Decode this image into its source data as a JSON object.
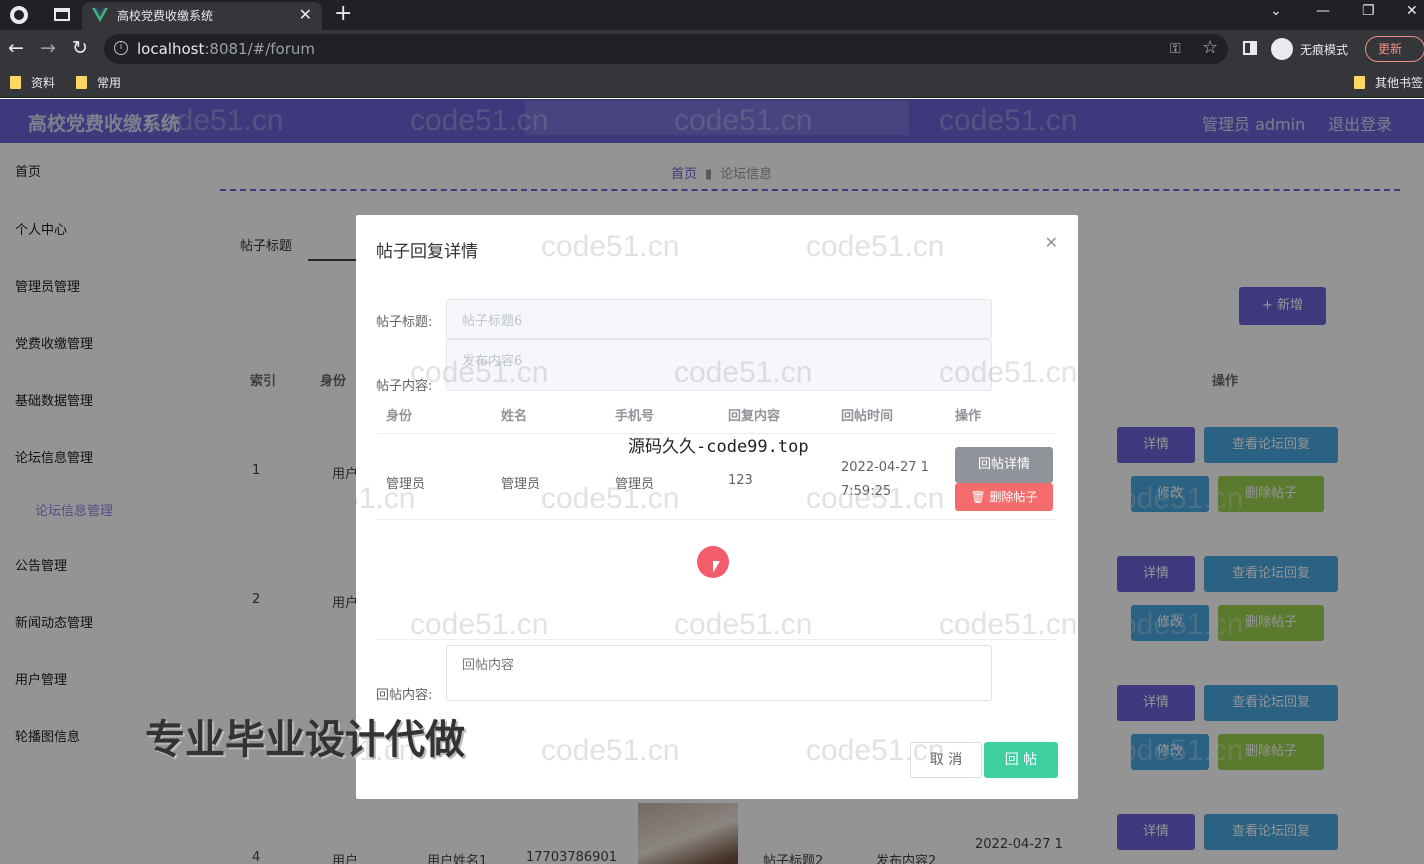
{
  "browser": {
    "tab_title": "高校党费收缴系统",
    "tab_close": "✕",
    "new_tab": "+",
    "url_host": "localhost",
    "url_rest": ":8081/#/forum",
    "incognito_label": "无痕模式",
    "update_label": "更新",
    "bookmarks": [
      "资料",
      "常用"
    ],
    "other_bookmarks": "其他书签",
    "win_min": "—",
    "win_max": "❐",
    "win_close": "✕",
    "tab_search": "⌄"
  },
  "header": {
    "title": "高校党费收缴系统",
    "user": "管理员 admin",
    "logout": "退出登录",
    "accent": "#6a63d6"
  },
  "sidebar": {
    "items": [
      "首页",
      "个人中心",
      "管理员管理",
      "党费收缴管理",
      "基础数据管理",
      "论坛信息管理",
      "公告管理",
      "新闻动态管理",
      "用户管理",
      "轮播图信息"
    ],
    "sub_item": "论坛信息管理"
  },
  "page": {
    "breadcrumb_home": "首页",
    "breadcrumb_current": "论坛信息",
    "search_label": "帖子标题",
    "add_button": "+ 新增",
    "columns": [
      "索引",
      "身份",
      "操作"
    ],
    "rows": [
      {
        "index": "1",
        "role": "用户"
      },
      {
        "index": "2",
        "role": "用户"
      },
      {
        "index": "4",
        "role": "用户",
        "name": "用户姓名1",
        "phone": "17703786901",
        "title": "帖子标题2",
        "content": "发布内容2",
        "time": "2022-04-27 1"
      }
    ],
    "op_detail": "详情",
    "op_replies": "查看论坛回复",
    "op_edit": "修改",
    "op_delete": "删除帖子"
  },
  "modal": {
    "title": "帖子回复详情",
    "title_label": "帖子标题:",
    "title_value": "帖子标题6",
    "content_label": "帖子内容:",
    "content_value": "发布内容6",
    "table_headers": [
      "身份",
      "姓名",
      "手机号",
      "回复内容",
      "回帖时间",
      "操作"
    ],
    "row": {
      "role": "管理员",
      "name": "管理员",
      "phone": "管理员",
      "reply": "123",
      "time_line1": "2022-04-27 1",
      "time_line2": "7:59:25"
    },
    "reply_detail_button": "回帖详情",
    "delete_button": "删除帖子",
    "reply_label": "回帖内容:",
    "reply_placeholder": "回帖内容",
    "cancel_button": "取 消",
    "submit_button": "回 帖"
  },
  "watermarks": {
    "site": "code51.cn",
    "center": "源码久久-code99.top",
    "ad": "专业毕业设计代做"
  }
}
